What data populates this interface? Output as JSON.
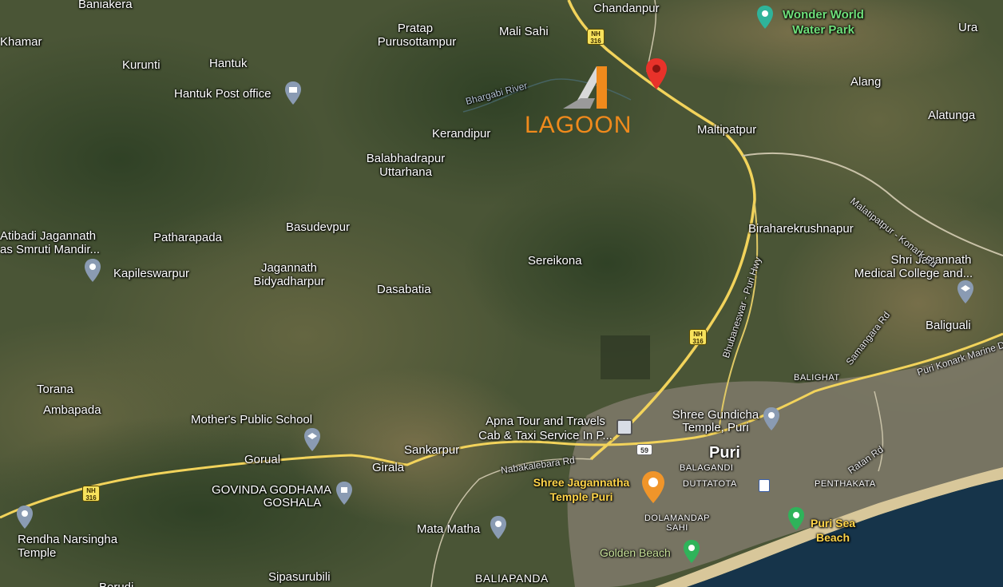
{
  "map": {
    "logo_text": "LAGOON",
    "places": [
      {
        "id": "baniakera",
        "name": "Baniakera"
      },
      {
        "id": "khamar",
        "name": "Khamar"
      },
      {
        "id": "kurunti",
        "name": "Kurunti"
      },
      {
        "id": "hantuk",
        "name": "Hantuk"
      },
      {
        "id": "hantuk-post-office",
        "name": "Hantuk Post office"
      },
      {
        "id": "pratap-1",
        "name": "Pratap"
      },
      {
        "id": "pratap-2",
        "name": "Purusottampur"
      },
      {
        "id": "mali-sahi",
        "name": "Mali Sahi"
      },
      {
        "id": "chandanpur",
        "name": "Chandanpur"
      },
      {
        "id": "ura",
        "name": "Ura"
      },
      {
        "id": "alang",
        "name": "Alang"
      },
      {
        "id": "alatunga",
        "name": "Alatunga"
      },
      {
        "id": "maltipatpur",
        "name": "Maltipatpur"
      },
      {
        "id": "kerandipur",
        "name": "Kerandipur"
      },
      {
        "id": "balabhadrapur-1",
        "name": "Balabhadrapur"
      },
      {
        "id": "balabhadrapur-2",
        "name": "Uttarhana"
      },
      {
        "id": "basudevpur",
        "name": "Basudevpur"
      },
      {
        "id": "patharapada",
        "name": "Patharapada"
      },
      {
        "id": "atibadi-1",
        "name": "Atibadi Jagannath"
      },
      {
        "id": "atibadi-2",
        "name": "as Smruti Mandir..."
      },
      {
        "id": "kapileswarpur",
        "name": "Kapileswarpur"
      },
      {
        "id": "jagannath-1",
        "name": "Jagannath"
      },
      {
        "id": "jagannath-2",
        "name": "Bidyadharpur"
      },
      {
        "id": "dasabatia",
        "name": "Dasabatia"
      },
      {
        "id": "sereikona",
        "name": "Sereikona"
      },
      {
        "id": "biraharekrushnapur",
        "name": "Biraharekrushnapur"
      },
      {
        "id": "shri-jagannath-medical-1",
        "name": "Shri Jagannath"
      },
      {
        "id": "shri-jagannath-medical-2",
        "name": "Medical College and..."
      },
      {
        "id": "baliguali",
        "name": "Baliguali"
      },
      {
        "id": "torana",
        "name": "Torana"
      },
      {
        "id": "ambapada",
        "name": "Ambapada"
      },
      {
        "id": "mothers-public-school",
        "name": "Mother's Public School"
      },
      {
        "id": "gorual",
        "name": "Gorual"
      },
      {
        "id": "girala",
        "name": "Girala"
      },
      {
        "id": "sankarpur",
        "name": "Sankarpur"
      },
      {
        "id": "apna-tour-1",
        "name": "Apna Tour and Travels"
      },
      {
        "id": "apna-tour-2",
        "name": "Cab & Taxi Service In P..."
      },
      {
        "id": "shree-gundicha-1",
        "name": "Shree Gundicha"
      },
      {
        "id": "shree-gundicha-2",
        "name": "Temple, Puri"
      },
      {
        "id": "puri",
        "name": "Puri"
      },
      {
        "id": "govinda-1",
        "name": "GOVINDA GODHAMA"
      },
      {
        "id": "govinda-2",
        "name": "GOSHALA"
      },
      {
        "id": "rendha-1",
        "name": "Rendha Narsingha"
      },
      {
        "id": "rendha-2",
        "name": "Temple"
      },
      {
        "id": "mata-matha",
        "name": "Mata Matha"
      },
      {
        "id": "sipasurubili",
        "name": "Sipasurubili"
      },
      {
        "id": "baliapanda",
        "name": "BALIAPANDA"
      },
      {
        "id": "golden-beach",
        "name": "Golden Beach"
      },
      {
        "id": "balighat",
        "name": "BALIGHAT"
      },
      {
        "id": "balagandi",
        "name": "BALAGANDI"
      },
      {
        "id": "duttatota",
        "name": "DUTTATOTA"
      },
      {
        "id": "penthakata",
        "name": "PENTHAKATA"
      },
      {
        "id": "dolamandap-1",
        "name": "DOLAMANDAP"
      },
      {
        "id": "dolamandap-2",
        "name": "SAHI"
      },
      {
        "id": "wonder-world-1",
        "name": "Wonder World"
      },
      {
        "id": "wonder-world-2",
        "name": "Water Park"
      },
      {
        "id": "shree-jagannatha-1",
        "name": "Shree Jagannatha"
      },
      {
        "id": "shree-jagannatha-2",
        "name": "Temple Puri"
      },
      {
        "id": "puri-sea-beach-1",
        "name": "Puri Sea"
      },
      {
        "id": "puri-sea-beach-2",
        "name": "Beach"
      },
      {
        "id": "berudi",
        "name": "Berudi"
      }
    ],
    "roads": [
      {
        "id": "bhargabi-river",
        "name": "Bhargabi River"
      },
      {
        "id": "malatipatpur-konark",
        "name": "Malatipatpur - Konark Rd"
      },
      {
        "id": "bhubaneswar-puri",
        "name": "Bhubaneswar - Puri Hwy"
      },
      {
        "id": "samangara",
        "name": "Samangara Rd"
      },
      {
        "id": "puri-konark-marine",
        "name": "Puri Konark Marine Dr"
      },
      {
        "id": "nabakalebara",
        "name": "Nabakalebara Rd"
      },
      {
        "id": "ratan",
        "name": "Ratan Rd"
      }
    ],
    "shields": [
      {
        "id": "nh316-top",
        "line1": "NH",
        "line2": "316"
      },
      {
        "id": "nh316-mid",
        "line1": "NH",
        "line2": "316"
      },
      {
        "id": "nh316-left",
        "line1": "NH",
        "line2": "316"
      },
      {
        "id": "sh59",
        "line1": "59",
        "line2": ""
      }
    ],
    "colors": {
      "road": "#f2d35b",
      "green_label": "#6fe07a",
      "yellow_label": "#ffd54a",
      "marker": "#e8322a",
      "logo": "#f08a1c",
      "sea": "#16344a"
    }
  }
}
